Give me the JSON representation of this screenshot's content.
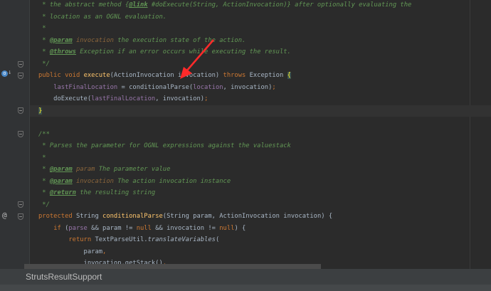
{
  "editor": {
    "highlighted_line": 9,
    "lines": [
      [
        [
          " * the abstract method ",
          "c"
        ],
        [
          "{",
          "c"
        ],
        [
          "@link",
          "tag"
        ],
        [
          " #doExecute(String, ActionInvocation)} after optionally evaluating the",
          "c"
        ]
      ],
      [
        [
          " * location as an OGNL evaluation.",
          "c"
        ]
      ],
      [
        [
          " *",
          "c"
        ]
      ],
      [
        [
          " * ",
          "c"
        ],
        [
          "@param",
          "tag"
        ],
        [
          " invocation",
          "pn"
        ],
        [
          " the execution state of the action.",
          "c"
        ]
      ],
      [
        [
          " * ",
          "c"
        ],
        [
          "@throws",
          "tag"
        ],
        [
          " Exception",
          "c"
        ],
        [
          " if an error occurs while executing the result.",
          "c"
        ]
      ],
      [
        [
          " */",
          "c"
        ]
      ],
      [
        [
          "public void ",
          "k"
        ],
        [
          "execute",
          "m"
        ],
        [
          "(ActionInvocation invocation) ",
          ""
        ],
        [
          "throws ",
          "k"
        ],
        [
          "Exception ",
          ""
        ],
        [
          "{",
          "brace"
        ]
      ],
      [
        [
          "    ",
          ""
        ],
        [
          "lastFinalLocation",
          "f"
        ],
        [
          " = conditionalParse(",
          ""
        ],
        [
          "location",
          "f"
        ],
        [
          ", invocation)",
          ""
        ],
        [
          ";",
          "k"
        ]
      ],
      [
        [
          "    doExecute(",
          ""
        ],
        [
          "lastFinalLocation",
          "f"
        ],
        [
          ", invocation)",
          ""
        ],
        [
          ";",
          "k"
        ]
      ],
      [
        [
          "}",
          "brace"
        ]
      ],
      [],
      [
        [
          "/**",
          "c"
        ]
      ],
      [
        [
          " * Parses the parameter for OGNL expressions against the valuestack",
          "c"
        ]
      ],
      [
        [
          " *",
          "c"
        ]
      ],
      [
        [
          " * ",
          "c"
        ],
        [
          "@param",
          "tag"
        ],
        [
          " param",
          "pn"
        ],
        [
          " The parameter value",
          "c"
        ]
      ],
      [
        [
          " * ",
          "c"
        ],
        [
          "@param",
          "tag"
        ],
        [
          " invocation",
          "pn"
        ],
        [
          " The action invocation instance",
          "c"
        ]
      ],
      [
        [
          " * ",
          "c"
        ],
        [
          "@return",
          "tag"
        ],
        [
          " the resulting string",
          "c"
        ]
      ],
      [
        [
          " */",
          "c"
        ]
      ],
      [
        [
          "protected ",
          "k"
        ],
        [
          "String ",
          ""
        ],
        [
          "conditionalParse",
          "m"
        ],
        [
          "(String param, ActionInvocation invocation) {",
          ""
        ]
      ],
      [
        [
          "    ",
          ""
        ],
        [
          "if ",
          "k"
        ],
        [
          "(",
          ""
        ],
        [
          "parse",
          "f"
        ],
        [
          " && param != ",
          ""
        ],
        [
          "null",
          "k"
        ],
        [
          " && invocation != ",
          ""
        ],
        [
          "null",
          "k"
        ],
        [
          ") {",
          ""
        ]
      ],
      [
        [
          "        ",
          ""
        ],
        [
          "return ",
          "k"
        ],
        [
          "TextParseUtil.",
          ""
        ],
        [
          "translateVariables",
          "st"
        ],
        [
          "(",
          ""
        ]
      ],
      [
        [
          "            param",
          ""
        ],
        [
          ",",
          "k"
        ]
      ],
      [
        [
          "            invocation.getStack()",
          ""
        ],
        [
          ",",
          "k"
        ]
      ]
    ]
  },
  "breadcrumb": "StrutsResultSupport",
  "colors": {
    "background": "#2b2b2b",
    "keyword": "#cc7832",
    "comment": "#629755",
    "annotation_arrow": "#ff2a2a"
  }
}
